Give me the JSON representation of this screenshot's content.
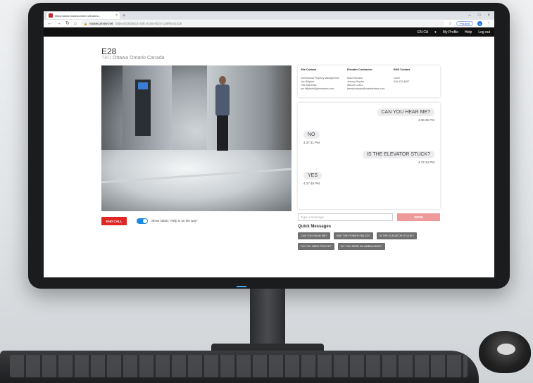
{
  "browser": {
    "tab_title": "https://www.mosecomme.net/video...",
    "tab_close": "×",
    "new_tab": "+",
    "url_host": "mosecomme.net",
    "url_path": "/video/53835614-34fc-4c05-8024-c29ff9441425",
    "paused_label": "Paused",
    "profile_initial": "A",
    "win_minimize": "–",
    "win_maximize": "□",
    "win_close": "×"
  },
  "nav": {
    "language": "EN CA",
    "my_profile": "My Profile",
    "help": "Help",
    "logout": "Log out"
  },
  "site": {
    "title": "E28",
    "sub_prefix": "TBD",
    "location": "Ottawa Ontario Canada"
  },
  "contacts": {
    "site": {
      "header": "Site Contact",
      "lines": [
        "Greenwood Property Management",
        "Joe Billybob",
        "705-456-2266",
        "joe.billybob@greenwood.com"
      ]
    },
    "elevator": {
      "header": "Elevator Contractor",
      "lines": [
        "MAD Elevator",
        "Jeremy Snyder",
        "555-207-4321",
        "jeremy.snyder@madelevator.com"
      ]
    },
    "ems": {
      "header": "EMS Contact",
      "lines": [
        "",
        "Carol",
        "416-123-4567",
        ""
      ]
    }
  },
  "chat": {
    "messages": [
      {
        "side": "right",
        "text": "CAN YOU HEAR ME?",
        "time": "4:36:45 PM"
      },
      {
        "side": "left",
        "text": "NO",
        "time": "4:37:41 PM"
      },
      {
        "side": "right",
        "text": "IS THE ELEVATOR STUCK?",
        "time": "4:37:44 PM"
      },
      {
        "side": "left",
        "text": "YES",
        "time": "4:37:48 PM"
      }
    ],
    "input_placeholder": "Type a message...",
    "send_label": "SEND"
  },
  "controls": {
    "end_call": "END CALL",
    "toggle_label": "Show status \"Help is on the way\"",
    "toggle_on": true
  },
  "quick_messages": {
    "title": "Quick Messages",
    "items": [
      "CAN YOU HEAR ME?",
      "HAS THE POWER FAILED?",
      "IS THE ELEVATOR STUCK?",
      "DO YOU NEED POLICE?",
      "DO YOU NEED AN AMBULANCE?"
    ]
  },
  "colors": {
    "accent_red": "#e02525",
    "send_disabled": "#ef9a9a",
    "toggle_blue": "#1e88e5",
    "quick_btn": "#6f6f6f"
  }
}
